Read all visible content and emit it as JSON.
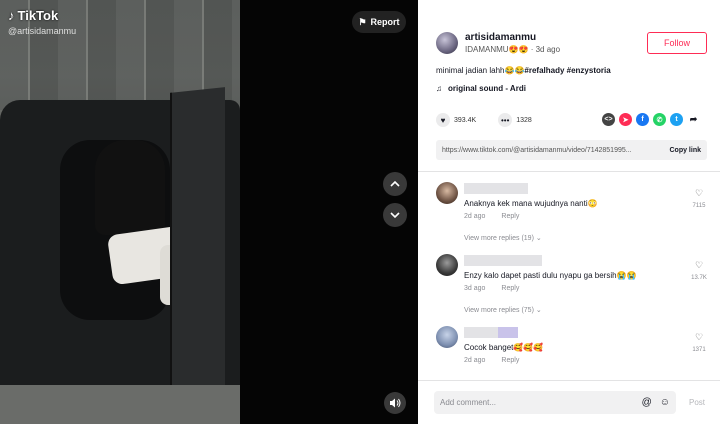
{
  "video": {
    "watermark_brand": "TikTok",
    "watermark_handle": "@artisidamanmu",
    "report_label": "Report"
  },
  "author": {
    "username": "artisidamanmu",
    "nickname": "IDAMANMU😍😍",
    "time": "3d ago",
    "follow_label": "Follow"
  },
  "caption": {
    "text": "minimal jadian lahh😂😂",
    "hashtags": "#refalhady #enzystoria"
  },
  "music": {
    "title": "original sound - Ardi"
  },
  "stats": {
    "likes": "393.4K",
    "comments": "1328"
  },
  "share": {
    "link": "https://www.tiktok.com/@artisidamanmu/video/7142851995...",
    "copy_label": "Copy link",
    "colors": {
      "embed": "#444444",
      "send": "#fe2c55",
      "facebook": "#1877f2",
      "whatsapp": "#25d366",
      "twitter": "#1da1f2"
    }
  },
  "comments": [
    {
      "text": "Anaknya kek mana wujudnya nanti😳",
      "time": "2d ago",
      "reply_label": "Reply",
      "likes": "7115",
      "view_replies": "View more replies (19)"
    },
    {
      "text": "Enzy kalo dapet pasti dulu nyapu ga bersih😭😭",
      "time": "3d ago",
      "reply_label": "Reply",
      "likes": "13.7K",
      "view_replies": "View more replies (75)"
    },
    {
      "text": "Cocok banget🥰🥰🥰",
      "time": "2d ago",
      "reply_label": "Reply",
      "likes": "1371"
    }
  ],
  "input": {
    "placeholder": "Add comment...",
    "post_label": "Post"
  },
  "colors": {
    "accent": "#fe2c55",
    "text": "#161823",
    "muted": "#8a8b91"
  }
}
